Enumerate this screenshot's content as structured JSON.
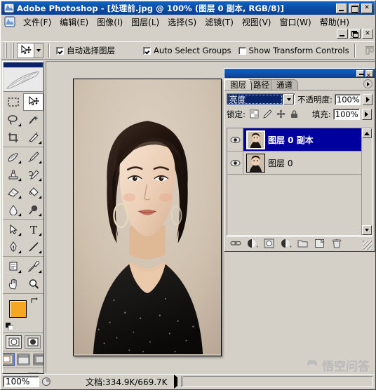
{
  "window": {
    "app_name": "Adobe Photoshop",
    "title": "Adobe Photoshop - [处理前.jpg @ 100% (图层 0 副本, RGB/8)]",
    "document_name": "处理前.jpg",
    "zoom_in_title": "100%",
    "layer_in_title": "图层 0 副本",
    "color_mode": "RGB/8",
    "app_icon": "photoshop-icon",
    "controls": {
      "minimize": "_",
      "maximize": "□",
      "close": "×"
    },
    "doc_controls": {
      "minimize": "_",
      "restore": "❐",
      "close": "×"
    }
  },
  "menubar": {
    "icon": "document-icon",
    "items": [
      {
        "label": "文件(F)"
      },
      {
        "label": "编辑(E)"
      },
      {
        "label": "图像(I)"
      },
      {
        "label": "图层(L)"
      },
      {
        "label": "选择(S)"
      },
      {
        "label": "滤镜(T)"
      },
      {
        "label": "视图(V)"
      },
      {
        "label": "窗口(W)"
      },
      {
        "label": "帮助(H)"
      }
    ]
  },
  "options_bar": {
    "active_tool_icon": "move-tool-icon",
    "tool_preset_dropdown": "chevron-down-icon",
    "checkboxes": [
      {
        "label": "自动选择图层",
        "checked": true,
        "name": "auto-select-layer"
      },
      {
        "label": "Auto Select Groups",
        "checked": true,
        "name": "auto-select-groups"
      },
      {
        "label": "Show Transform Controls",
        "checked": false,
        "name": "show-transform-controls"
      }
    ],
    "align_icons": [
      "align-top-edges-icon",
      "align-vertical-centers-icon",
      "align-bottom-edges-icon"
    ]
  },
  "toolbox": {
    "logo_icon": "feather-logo-icon",
    "tools": [
      {
        "name": "marquee-tool",
        "icon": "rectangular-marquee-icon",
        "selected": false,
        "has_flyout": false
      },
      {
        "name": "move-tool",
        "icon": "move-tool-icon",
        "selected": true,
        "has_flyout": false
      },
      {
        "name": "lasso-tool",
        "icon": "lasso-icon",
        "selected": false,
        "has_flyout": true
      },
      {
        "name": "magic-wand-tool",
        "icon": "magic-wand-icon",
        "selected": false,
        "has_flyout": false
      },
      {
        "name": "crop-tool",
        "icon": "crop-icon",
        "selected": false,
        "has_flyout": false
      },
      {
        "name": "slice-tool",
        "icon": "slice-knife-icon",
        "selected": false,
        "has_flyout": true
      },
      {
        "name": "healing-brush-tool",
        "icon": "healing-brush-icon",
        "selected": false,
        "has_flyout": true
      },
      {
        "name": "brush-tool",
        "icon": "paintbrush-icon",
        "selected": false,
        "has_flyout": true
      },
      {
        "name": "clone-stamp-tool",
        "icon": "clone-stamp-icon",
        "selected": false,
        "has_flyout": true
      },
      {
        "name": "history-brush-tool",
        "icon": "history-brush-icon",
        "selected": false,
        "has_flyout": true
      },
      {
        "name": "eraser-tool",
        "icon": "eraser-icon",
        "selected": false,
        "has_flyout": true
      },
      {
        "name": "gradient-tool",
        "icon": "paint-bucket-icon",
        "selected": false,
        "has_flyout": true
      },
      {
        "name": "blur-tool",
        "icon": "blur-drop-icon",
        "selected": false,
        "has_flyout": true
      },
      {
        "name": "dodge-tool",
        "icon": "dodge-burn-icon",
        "selected": false,
        "has_flyout": true
      },
      {
        "name": "path-selection-tool",
        "icon": "path-arrow-icon",
        "selected": false,
        "has_flyout": true
      },
      {
        "name": "type-tool",
        "icon": "type-T-icon",
        "selected": false,
        "has_flyout": true
      },
      {
        "name": "pen-tool",
        "icon": "pen-nib-icon",
        "selected": false,
        "has_flyout": true
      },
      {
        "name": "line-tool",
        "icon": "line-shape-icon",
        "selected": false,
        "has_flyout": true
      },
      {
        "name": "notes-tool",
        "icon": "notes-icon",
        "selected": false,
        "has_flyout": true
      },
      {
        "name": "eyedropper-tool",
        "icon": "eyedropper-icon",
        "selected": false,
        "has_flyout": true
      },
      {
        "name": "hand-tool",
        "icon": "hand-icon",
        "selected": false,
        "has_flyout": false
      },
      {
        "name": "zoom-tool",
        "icon": "magnifier-icon",
        "selected": false,
        "has_flyout": false
      }
    ],
    "colors": {
      "foreground": "#F5A623",
      "background": "#FFFFFF",
      "swap_icon": "swap-colors-icon",
      "default_icon": "default-colors-icon"
    },
    "quickmask": [
      {
        "name": "standard-mode",
        "icon": "standard-mode-icon",
        "selected": true
      },
      {
        "name": "quick-mask-mode",
        "icon": "quick-mask-icon",
        "selected": false
      }
    ],
    "screen_modes": [
      {
        "name": "standard-screen-mode",
        "icon": "standard-screen-icon",
        "selected": true
      },
      {
        "name": "full-screen-menubar-mode",
        "icon": "full-screen-menubar-icon",
        "selected": false
      },
      {
        "name": "full-screen-mode",
        "icon": "full-screen-icon",
        "selected": false
      }
    ],
    "jump_to": [
      {
        "name": "jump-to-imageready",
        "icon": "imageready-jump-icon"
      },
      {
        "name": "jump-to-icon-2",
        "icon": "imageready-logo-icon"
      }
    ]
  },
  "layers_palette": {
    "tabs": [
      {
        "label": "图层",
        "active": true,
        "name": "tab-layers"
      },
      {
        "label": "路径",
        "active": false,
        "name": "tab-paths"
      },
      {
        "label": "通道",
        "active": false,
        "name": "tab-channels"
      }
    ],
    "menu_icon": "palette-menu-icon",
    "minimize": "_",
    "close": "×",
    "blend_mode": "亮度",
    "blend_dropdown_icon": "chevron-down-icon",
    "opacity_label": "不透明度:",
    "opacity_value": "100%",
    "lock_label": "锁定:",
    "lock_icons": [
      {
        "name": "lock-transparent-pixels-icon"
      },
      {
        "name": "lock-image-pixels-icon"
      },
      {
        "name": "lock-position-icon"
      },
      {
        "name": "lock-all-icon"
      }
    ],
    "fill_label": "填充:",
    "fill_value": "100%",
    "layers": [
      {
        "name": "图层 0 副本",
        "visible": true,
        "selected": true,
        "eye_icon": "eye-icon",
        "thumb": "portrait-thumbnail"
      },
      {
        "name": "图层 0",
        "visible": true,
        "selected": false,
        "eye_icon": "eye-icon",
        "thumb": "portrait-thumbnail"
      }
    ],
    "footer_icons": [
      {
        "name": "link-layers-icon"
      },
      {
        "name": "layer-style-fx-icon"
      },
      {
        "name": "layer-mask-icon"
      },
      {
        "name": "adjustment-layer-icon"
      },
      {
        "name": "new-group-icon"
      },
      {
        "name": "new-layer-icon"
      },
      {
        "name": "delete-layer-icon"
      }
    ]
  },
  "canvas": {
    "image_alt": "portrait-photo-of-smiling-woman",
    "description": "处理前.jpg"
  },
  "statusbar": {
    "zoom_value": "100%",
    "doc_icon": "document-size-icon",
    "info_text": "文档:334.9K/669.7K",
    "expand_icon": "play-arrow-icon"
  },
  "watermark": {
    "text": "悟空问答",
    "icon": "wukong-logo-icon"
  },
  "colors": {
    "titlebar_blue": "#0a4ea8",
    "selection_blue": "#00009f",
    "chrome_gray": "#d4d0c8",
    "foreground_swatch": "#F5A623"
  }
}
